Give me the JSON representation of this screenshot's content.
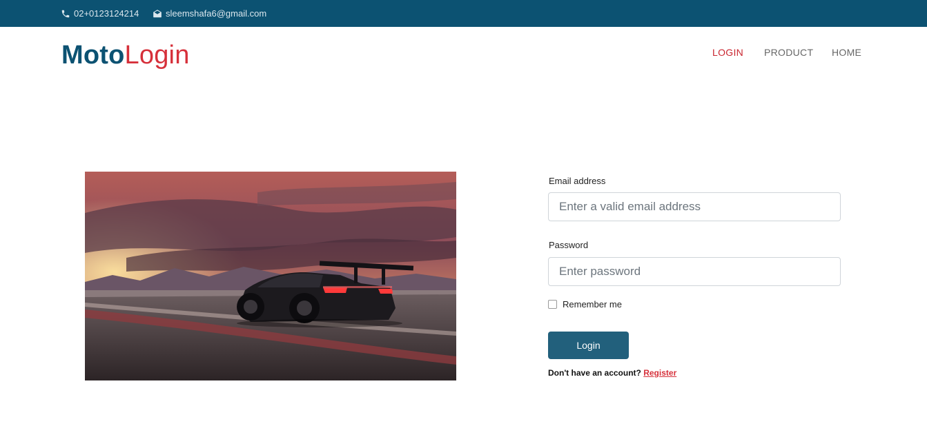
{
  "topbar": {
    "phone": "02+0123124214",
    "email": "sleemshafa6@gmail.com"
  },
  "brand": {
    "part1": "Moto",
    "part2": "Login",
    "colors": {
      "primary": "#0c5272",
      "accent": "#d6303a"
    }
  },
  "nav": {
    "items": [
      {
        "label": "LOGIN",
        "active": true
      },
      {
        "label": "PRODUCT",
        "active": false
      },
      {
        "label": "HOME",
        "active": false
      }
    ]
  },
  "form": {
    "email_label": "Email address",
    "email_placeholder": "Enter a valid email address",
    "email_value": "",
    "password_label": "Password",
    "password_placeholder": "Enter password",
    "password_value": "",
    "remember_label": "Remember me",
    "remember_checked": false,
    "submit_label": "Login",
    "signup_prompt": "Don't have an account?",
    "signup_link": "Register"
  },
  "icons": [
    "phone-icon",
    "envelope-icon"
  ]
}
